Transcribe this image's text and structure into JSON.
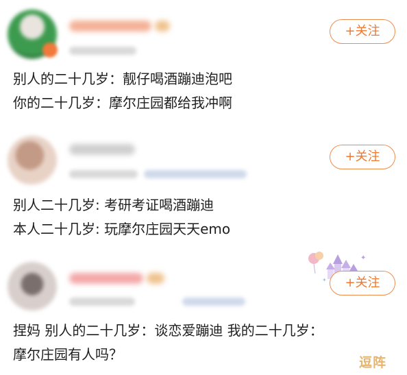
{
  "follow_label": "+关注",
  "posts": [
    {
      "lines": [
        "别人的二十几岁：靓仔喝酒蹦迪泡吧",
        "你的二十几岁：摩尔庄园都给我冲啊"
      ]
    },
    {
      "lines": [
        "别人二十几岁: 考研考证喝酒蹦迪",
        "本人二十几岁: 玩摩尔庄园天天emo"
      ]
    },
    {
      "lines": [
        "捏妈 别人的二十几岁：谈恋爱蹦迪 我的二十几岁：",
        "摩尔庄园有人吗？"
      ]
    }
  ],
  "watermark": "逗阵",
  "colors": {
    "accent": "#f0782d",
    "text": "#1f1f1f"
  }
}
